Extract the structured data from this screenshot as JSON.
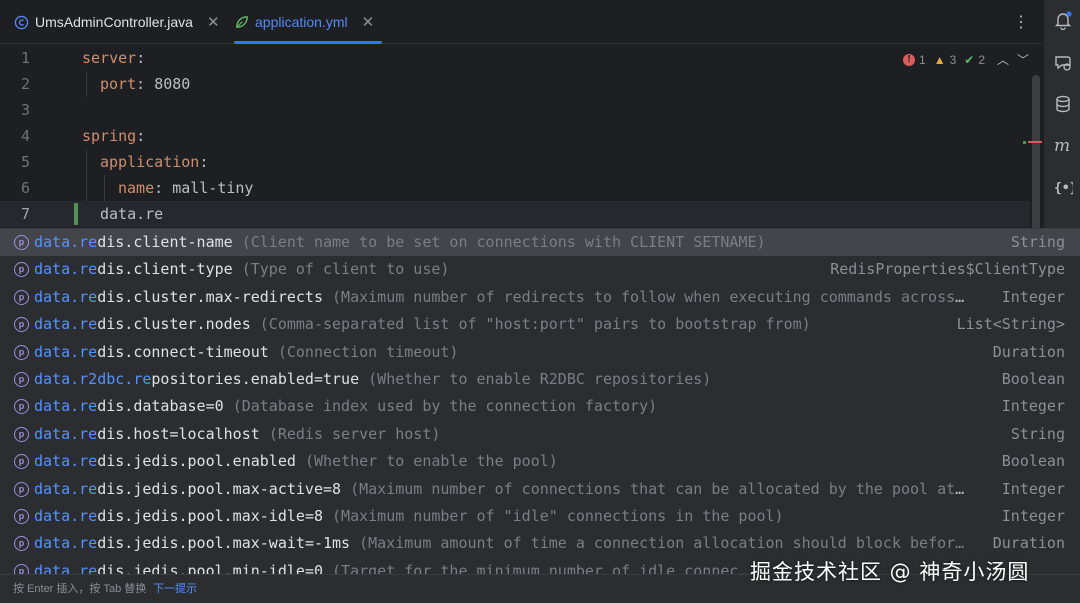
{
  "tabs": [
    {
      "label": "UmsAdminController.java",
      "icon": "java-class-icon",
      "active": false
    },
    {
      "label": "application.yml",
      "icon": "spring-leaf-icon",
      "active": true
    }
  ],
  "tab_close": "✕",
  "tab_menu": "⋮",
  "inspections": {
    "errors": "1",
    "warnings": "3",
    "weak": "2"
  },
  "editor": {
    "lines": [
      {
        "num": "1",
        "key": "server",
        "sep": ":",
        "value": ""
      },
      {
        "num": "2",
        "key": "port",
        "sep": ": ",
        "value": "8080"
      },
      {
        "num": "3",
        "key": "",
        "sep": "",
        "value": ""
      },
      {
        "num": "4",
        "key": "spring",
        "sep": ":",
        "value": ""
      },
      {
        "num": "5",
        "key": "application",
        "sep": ":",
        "value": ""
      },
      {
        "num": "6",
        "key": "name",
        "sep": ": ",
        "value": "mall-tiny"
      },
      {
        "num": "7",
        "key": "",
        "sep": "",
        "value": "data.re"
      }
    ]
  },
  "completion": {
    "items": [
      {
        "prefix": "data.",
        "m1": "re",
        "rest": "dis.client-name",
        "dflt": "",
        "desc": "(Client name to be set on connections with CLIENT SETNAME)",
        "type": "String"
      },
      {
        "prefix": "data.",
        "m1": "re",
        "rest": "dis.client-type",
        "dflt": "",
        "desc": "(Type of client to use)",
        "type": "RedisProperties$ClientType"
      },
      {
        "prefix": "data.",
        "m1": "re",
        "rest": "dis.cluster.max-redirects",
        "dflt": "",
        "desc": "(Maximum number of redirects to follow when executing commands across …",
        "type": "Integer"
      },
      {
        "prefix": "data.",
        "m1": "re",
        "rest": "dis.cluster.nodes",
        "dflt": "",
        "desc": "(Comma-separated list of \"host:port\" pairs to bootstrap from)",
        "type": "List<String>"
      },
      {
        "prefix": "data.",
        "m1": "re",
        "rest": "dis.connect-timeout",
        "dflt": "",
        "desc": "(Connection timeout)",
        "type": "Duration"
      },
      {
        "prefix": "data.r2dbc.",
        "m1": "re",
        "rest": "positories.enabled",
        "dflt": "=true",
        "desc": "(Whether to enable R2DBC repositories)",
        "type": "Boolean"
      },
      {
        "prefix": "data.",
        "m1": "re",
        "rest": "dis.database",
        "dflt": "=0",
        "desc": "(Database index used by the connection factory)",
        "type": "Integer"
      },
      {
        "prefix": "data.",
        "m1": "re",
        "rest": "dis.host",
        "dflt": "=localhost",
        "desc": "(Redis server host)",
        "type": "String"
      },
      {
        "prefix": "data.",
        "m1": "re",
        "rest": "dis.jedis.pool.enabled",
        "dflt": "",
        "desc": "(Whether to enable the pool)",
        "type": "Boolean"
      },
      {
        "prefix": "data.",
        "m1": "re",
        "rest": "dis.jedis.pool.max-active",
        "dflt": "=8",
        "desc": "(Maximum number of connections that can be allocated by the pool at …",
        "type": "Integer"
      },
      {
        "prefix": "data.",
        "m1": "re",
        "rest": "dis.jedis.pool.max-idle",
        "dflt": "=8",
        "desc": "(Maximum number of \"idle\" connections in the pool)",
        "type": "Integer"
      },
      {
        "prefix": "data.",
        "m1": "re",
        "rest": "dis.jedis.pool.max-wait",
        "dflt": "=-1ms",
        "desc": "(Maximum amount of time a connection allocation should block befor…",
        "type": "Duration"
      },
      {
        "prefix": "data.",
        "m1": "re",
        "rest": "dis.jedis.pool.min-idle",
        "dflt": "=0",
        "desc": "(Target for the minimum number of idle connec…",
        "type": ""
      }
    ],
    "footer_hint": "按 Enter 插入，按 Tab 替换",
    "footer_next": "下一提示"
  },
  "watermark": "掘金技术社区 @ 神奇小汤圆",
  "colors": {
    "accent": "#3574f0",
    "match": "#5592ff",
    "key": "#cf8e6d",
    "background": "#1e1f22",
    "popup": "#2b2d30"
  }
}
